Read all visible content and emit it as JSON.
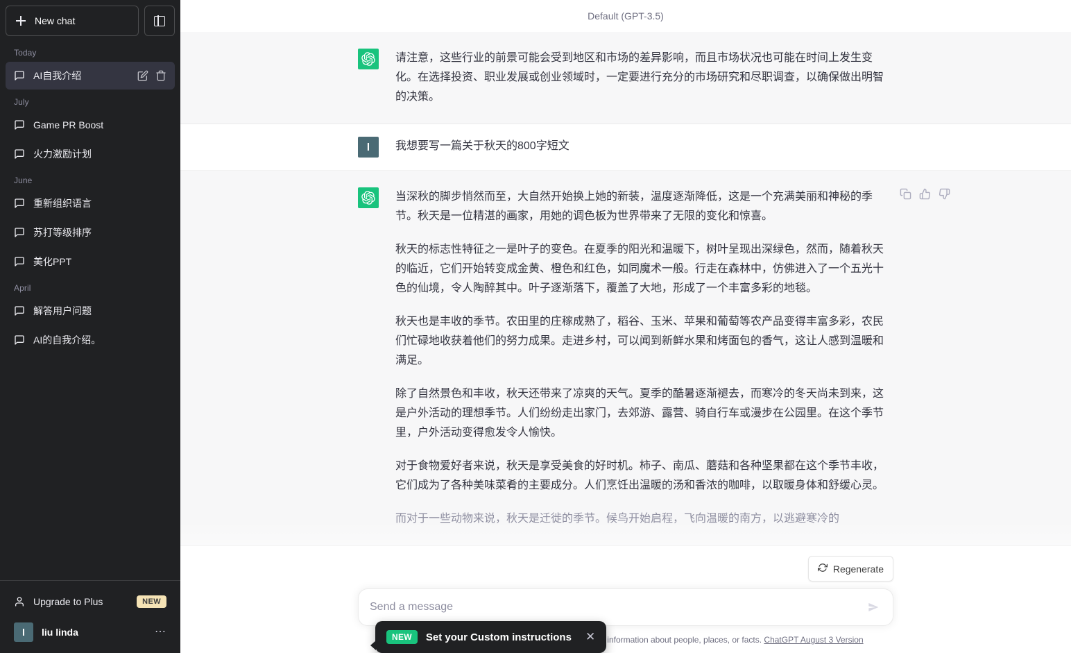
{
  "sidebar": {
    "new_chat_label": "New chat",
    "collapse_icon": "panel-left-icon",
    "groups": [
      {
        "label": "Today",
        "items": [
          {
            "title": "AI自我介绍",
            "active": true,
            "icon": "chat-bubble-icon"
          }
        ]
      },
      {
        "label": "July",
        "items": [
          {
            "title": "Game PR Boost",
            "active": false,
            "icon": "chat-bubble-icon"
          },
          {
            "title": "火力激励计划",
            "active": false,
            "icon": "chat-bubble-icon"
          }
        ]
      },
      {
        "label": "June",
        "items": [
          {
            "title": "重新组织语言",
            "active": false,
            "icon": "chat-bubble-icon"
          },
          {
            "title": "苏打等级排序",
            "active": false,
            "icon": "chat-bubble-icon"
          },
          {
            "title": "美化PPT",
            "active": false,
            "icon": "chat-bubble-icon"
          }
        ]
      },
      {
        "label": "April",
        "items": [
          {
            "title": "解答用户问题",
            "active": false,
            "icon": "chat-bubble-icon"
          },
          {
            "title": "AI的自我介绍。",
            "active": false,
            "icon": "chat-bubble-icon"
          }
        ]
      }
    ],
    "edit_icon": "pencil-icon",
    "delete_icon": "trash-icon",
    "upgrade": {
      "label": "Upgrade to Plus",
      "badge": "NEW",
      "icon": "person-icon"
    },
    "account": {
      "name": "liu linda",
      "avatar_initial": "l",
      "menu_icon": "ellipsis-icon"
    }
  },
  "header": {
    "model_label": "Default (GPT-3.5)"
  },
  "conversation": {
    "messages": [
      {
        "role": "assistant",
        "avatar": "openai-logo",
        "paragraphs": [
          "请注意，这些行业的前景可能会受到地区和市场的差异影响，而且市场状况也可能在时间上发生变化。在选择投资、职业发展或创业领域时，一定要进行充分的市场研究和尽职调查，以确保做出明智的决策。"
        ]
      },
      {
        "role": "user",
        "avatar_initial": "l",
        "paragraphs": [
          "我想要写一篇关于秋天的800字短文"
        ]
      },
      {
        "role": "assistant",
        "avatar": "openai-logo",
        "paragraphs": [
          "当深秋的脚步悄然而至，大自然开始换上她的新装，温度逐渐降低，这是一个充满美丽和神秘的季节。秋天是一位精湛的画家，用她的调色板为世界带来了无限的变化和惊喜。",
          "秋天的标志性特征之一是叶子的变色。在夏季的阳光和温暖下，树叶呈现出深绿色，然而，随着秋天的临近，它们开始转变成金黄、橙色和红色，如同魔术一般。行走在森林中，仿佛进入了一个五光十色的仙境，令人陶醉其中。叶子逐渐落下，覆盖了大地，形成了一个丰富多彩的地毯。",
          "秋天也是丰收的季节。农田里的庄稼成熟了，稻谷、玉米、苹果和葡萄等农产品变得丰富多彩，农民们忙碌地收获着他们的努力成果。走进乡村，可以闻到新鲜水果和烤面包的香气，这让人感到温暖和满足。",
          "除了自然景色和丰收，秋天还带来了凉爽的天气。夏季的酷暑逐渐褪去，而寒冷的冬天尚未到来，这是户外活动的理想季节。人们纷纷走出家门，去郊游、露营、骑自行车或漫步在公园里。在这个季节里，户外活动变得愈发令人愉快。",
          "对于食物爱好者来说，秋天是享受美食的好时机。柿子、南瓜、蘑菇和各种坚果都在这个季节丰收，它们成为了各种美味菜肴的主要成分。人们烹饪出温暖的汤和香浓的咖啡，以取暖身体和舒缓心灵。"
        ],
        "faded_paragraph": "而对于一些动物来说，秋天是迁徙的季节。候鸟开始启程，飞向温暖的南方，以逃避寒冷的",
        "actions": [
          {
            "name": "copy-icon",
            "title": "Copy"
          },
          {
            "name": "thumbs-up-icon",
            "title": "Good response"
          },
          {
            "name": "thumbs-down-icon",
            "title": "Bad response"
          }
        ]
      }
    ]
  },
  "composer": {
    "regenerate_label": "Regenerate",
    "regenerate_icon": "refresh-icon",
    "placeholder": "Send a message",
    "value": "",
    "send_icon": "send-icon",
    "disclaimer_text": "Free Research Preview. ChatGPT may produce inaccurate information about people, places, or facts.",
    "disclaimer_link": "ChatGPT August 3 Version"
  },
  "toast": {
    "badge": "NEW",
    "text": "Set your Custom instructions",
    "close_icon": "close-icon"
  },
  "colors": {
    "sidebar_bg": "#202123",
    "active_item": "#343541",
    "assistant_bg": "#f7f7f8",
    "brand_green": "#19c37d",
    "badge_yellow": "#f5e3b5",
    "text_primary": "#343541",
    "text_muted": "#8e8ea0"
  }
}
